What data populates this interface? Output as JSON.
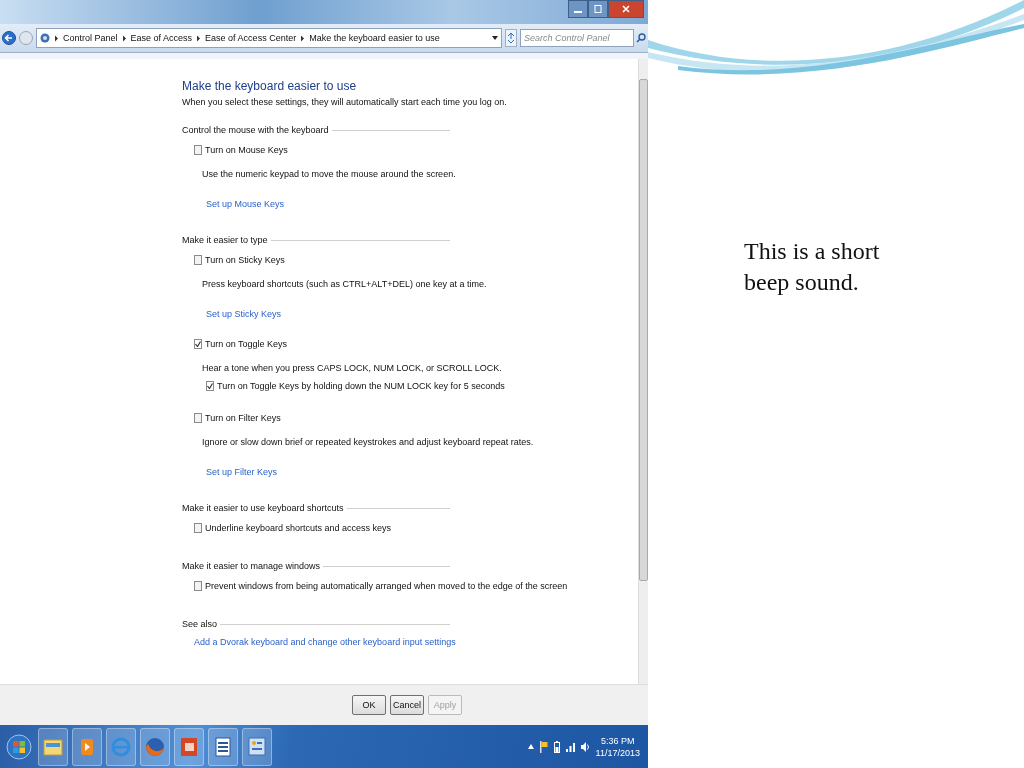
{
  "address_bar": {
    "breadcrumbs": [
      "Control Panel",
      "Ease of Access",
      "Ease of Access Center",
      "Make the keyboard easier to use"
    ],
    "search": {
      "placeholder": "Search Control Panel"
    }
  },
  "page": {
    "title": "Make the keyboard easier to use",
    "subtitle": "When you select these settings, they will automatically start each time you log on.",
    "sections": [
      {
        "heading": "Control the mouse with the keyboard",
        "items": [
          {
            "kind": "checkbox",
            "label": "Turn on Mouse Keys",
            "checked": false,
            "description": "Use the numeric keypad to move the mouse around the screen.",
            "link": "Set up Mouse Keys"
          }
        ]
      },
      {
        "heading": "Make it easier to type",
        "items": [
          {
            "kind": "checkbox",
            "label": "Turn on Sticky Keys",
            "checked": false,
            "description": "Press keyboard shortcuts (such as CTRL+ALT+DEL) one key at a time.",
            "link": "Set up Sticky Keys"
          },
          {
            "kind": "checkbox",
            "label": "Turn on Toggle Keys",
            "checked": true,
            "description": "Hear a tone when you press CAPS LOCK, NUM LOCK, or SCROLL LOCK.",
            "children": [
              {
                "kind": "checkbox",
                "label": "Turn on Toggle Keys by holding down the NUM LOCK key for 5 seconds",
                "checked": true
              }
            ]
          },
          {
            "kind": "checkbox",
            "label": "Turn on Filter Keys",
            "checked": false,
            "description": "Ignore or slow down brief or repeated keystrokes and adjust keyboard repeat rates.",
            "link": "Set up Filter Keys"
          }
        ]
      },
      {
        "heading": "Make it easier to use keyboard shortcuts",
        "items": [
          {
            "kind": "checkbox",
            "label": "Underline keyboard shortcuts and access keys",
            "checked": false
          }
        ]
      },
      {
        "heading": "Make it easier to manage windows",
        "items": [
          {
            "kind": "checkbox",
            "label": "Prevent windows from being automatically arranged when moved to the edge of the screen",
            "checked": false
          }
        ]
      },
      {
        "heading": "See also",
        "items": [
          {
            "kind": "link",
            "text": "Add a Dvorak keyboard and change other keyboard input settings"
          }
        ]
      }
    ]
  },
  "buttons": [
    {
      "label": "OK",
      "disabled": false
    },
    {
      "label": "Cancel",
      "disabled": false
    },
    {
      "label": "Apply",
      "disabled": true
    }
  ],
  "taskbar": {
    "apps": [
      {
        "kind": "start"
      },
      {
        "kind": "explorer"
      },
      {
        "kind": "media"
      },
      {
        "kind": "ie"
      },
      {
        "kind": "firefox"
      },
      {
        "kind": "powerpoint"
      },
      {
        "kind": "word"
      },
      {
        "kind": "control"
      }
    ],
    "time": "5:36 PM",
    "date": "11/17/2013"
  },
  "slide": {
    "text": "This is a short beep sound."
  }
}
